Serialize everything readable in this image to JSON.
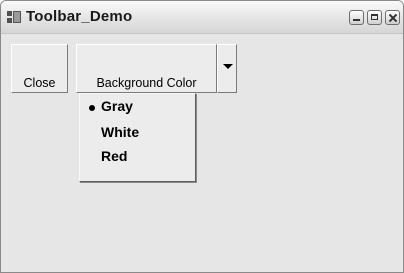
{
  "window": {
    "title": "Toolbar_Demo"
  },
  "toolbar": {
    "close_label": "Close",
    "background_label": "Background Color"
  },
  "background_menu": {
    "items": [
      {
        "label": "Gray",
        "checked": true
      },
      {
        "label": "White",
        "checked": false
      },
      {
        "label": "Red",
        "checked": false
      }
    ]
  },
  "icons": {
    "app": "app-window-icon",
    "minimize": "minimize-icon",
    "maximize": "maximize-icon",
    "close": "close-icon",
    "dropdown": "dropdown-arrow-icon",
    "checked": "radio-dot-icon"
  }
}
